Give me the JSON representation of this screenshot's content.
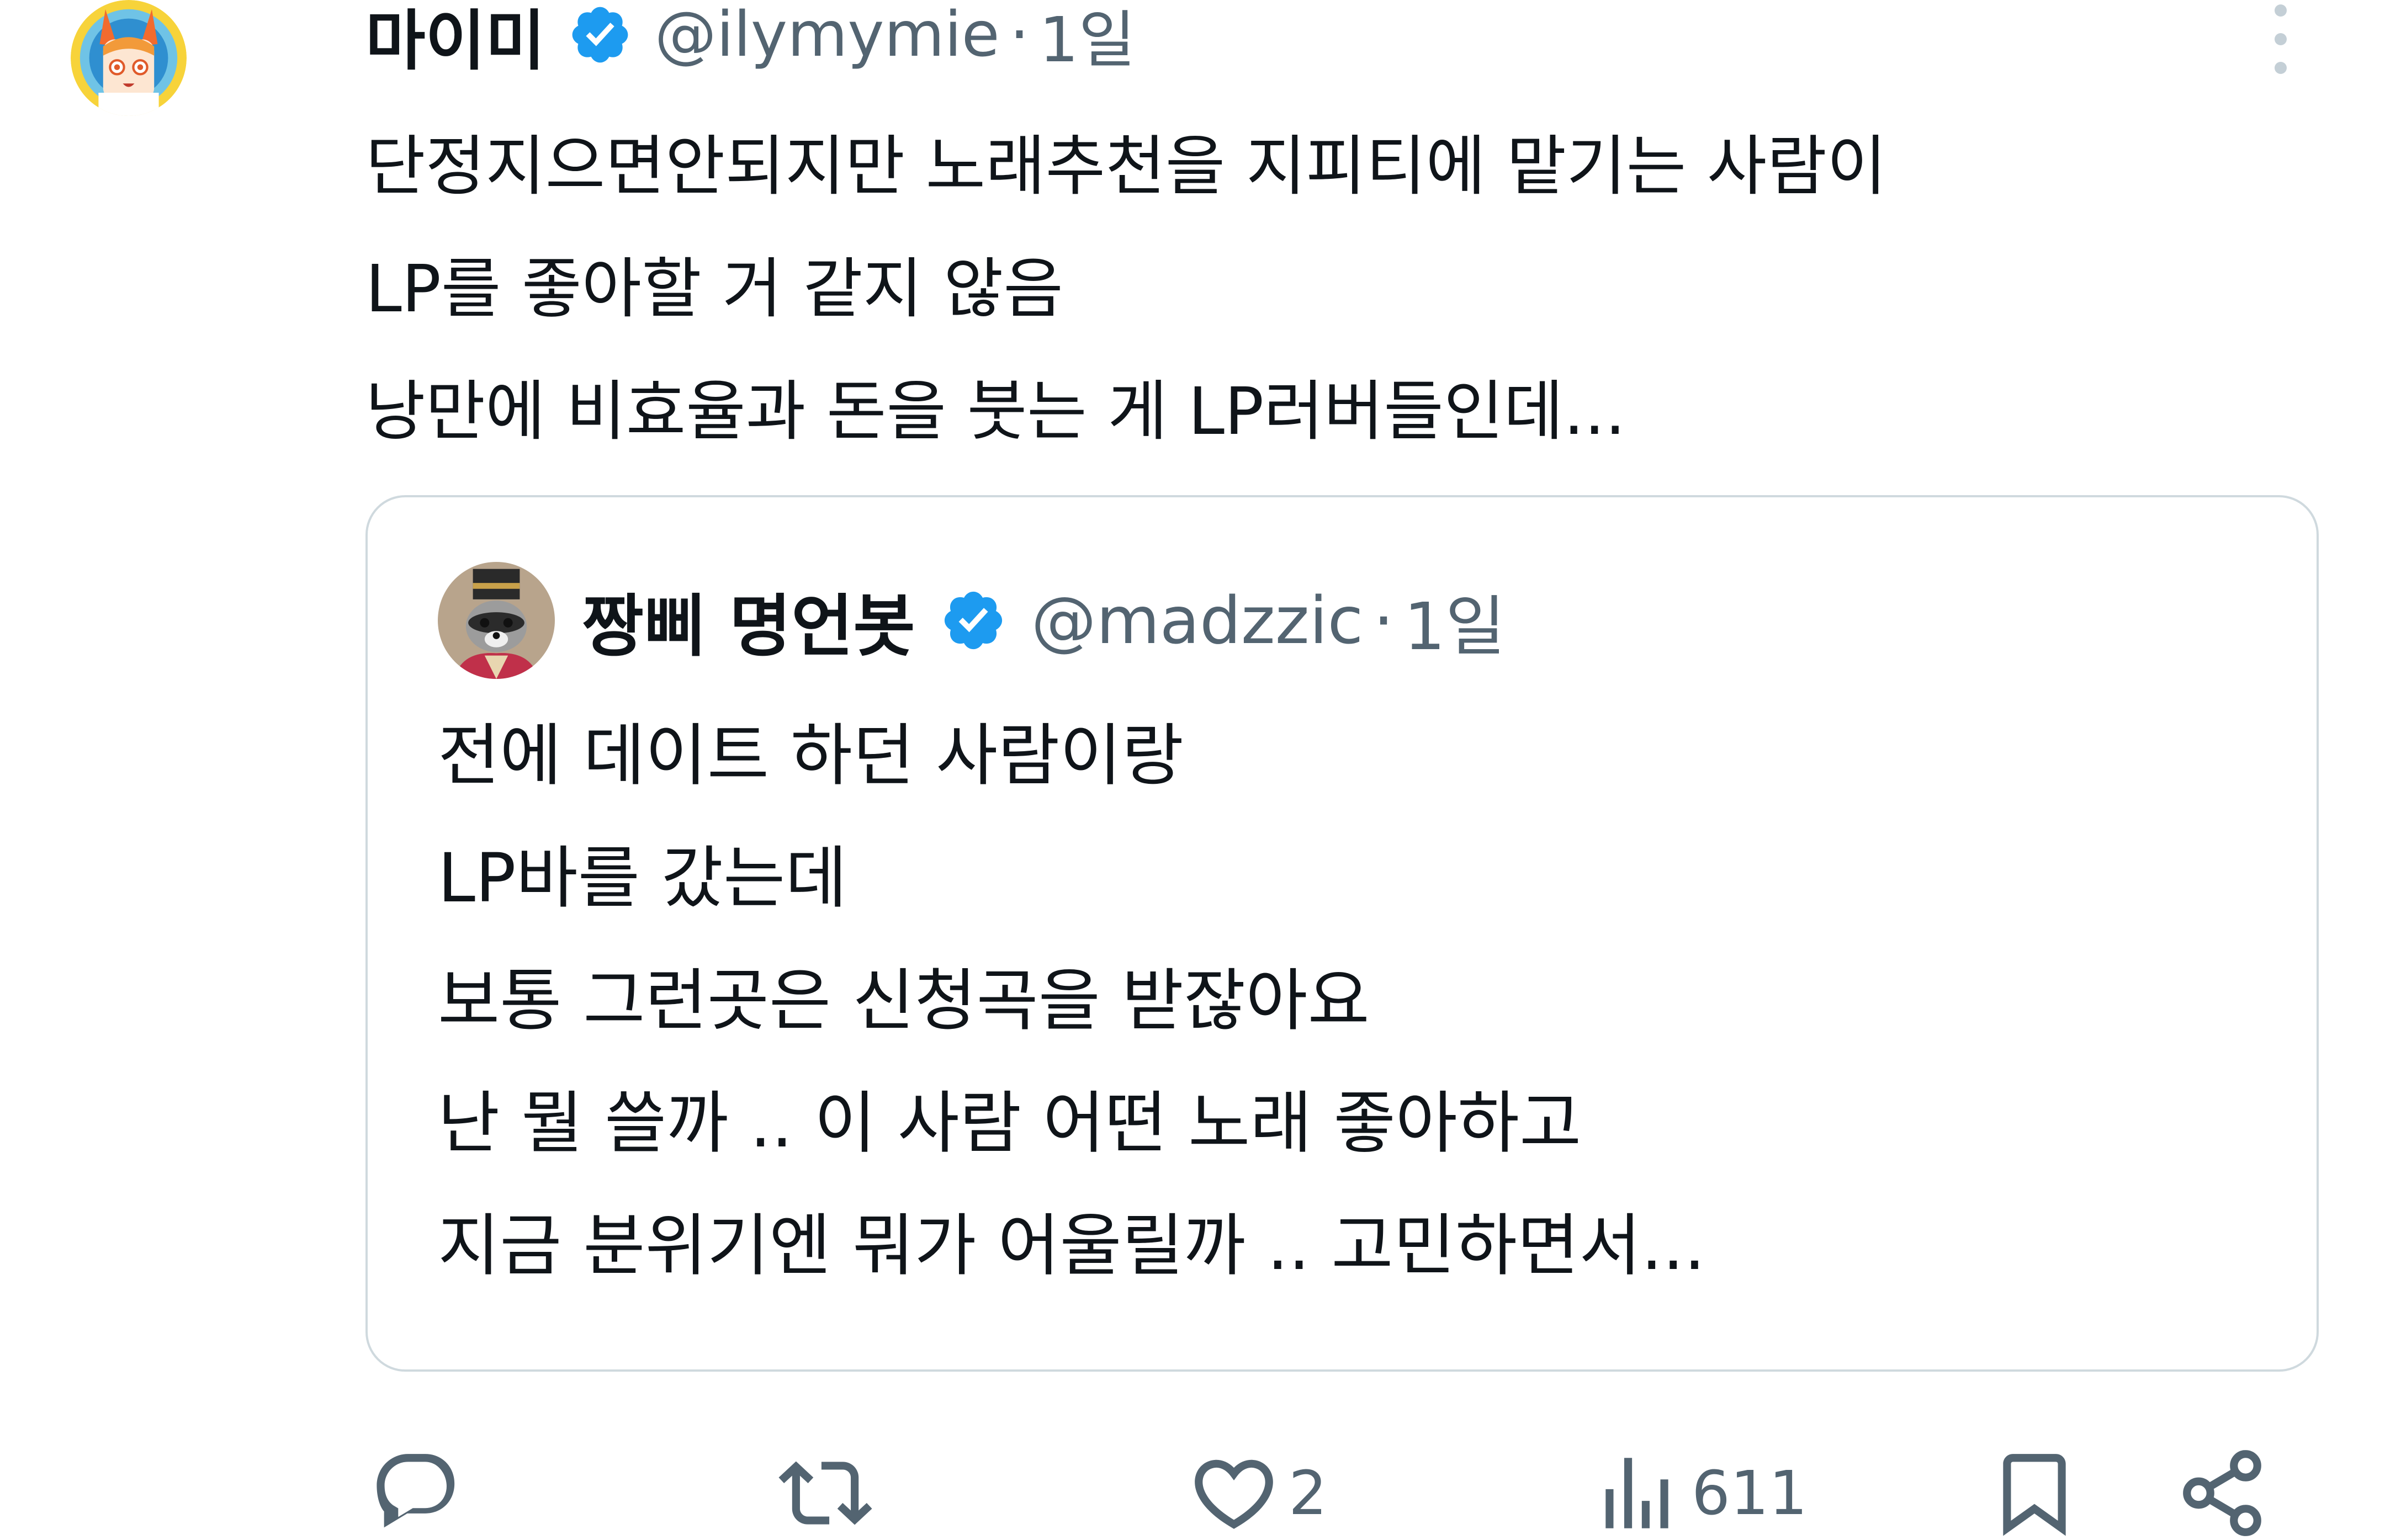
{
  "author": {
    "display_name": "마이미",
    "handle": "@ilymymie",
    "separator": "·",
    "time": "1일"
  },
  "tweet": {
    "text": "단정지으면안되지만 노래추천을 지피티에 맡기는 사람이\nLP를 좋아할 거 같지 않음\n낭만에 비효율과 돈을 붓는 게 LP러버들인데..."
  },
  "quote": {
    "display_name": "짱삐 명언봇",
    "handle": "@madzzic",
    "separator": "·",
    "time": "1일",
    "text": "전에 데이트 하던 사람이랑\nLP바를 갔는데\n보통 그런곳은 신청곡을 받잖아요\n난 뭘 쓸까 .. 이 사람 어떤 노래 좋아하고\n지금 분위기엔 뭐가 어울릴까 .. 고민하면서..."
  },
  "actions": {
    "reply_icon": "reply-icon",
    "retweet_icon": "retweet-icon",
    "like_icon": "heart-icon",
    "like_count": "2",
    "views_icon": "views-chart-icon",
    "views_count": "611",
    "bookmark_icon": "bookmark-icon",
    "share_icon": "share-icon"
  },
  "colors": {
    "text": "#0f1419",
    "secondary": "#536471",
    "verified": "#1d9bf0",
    "border": "#cfd9de"
  }
}
